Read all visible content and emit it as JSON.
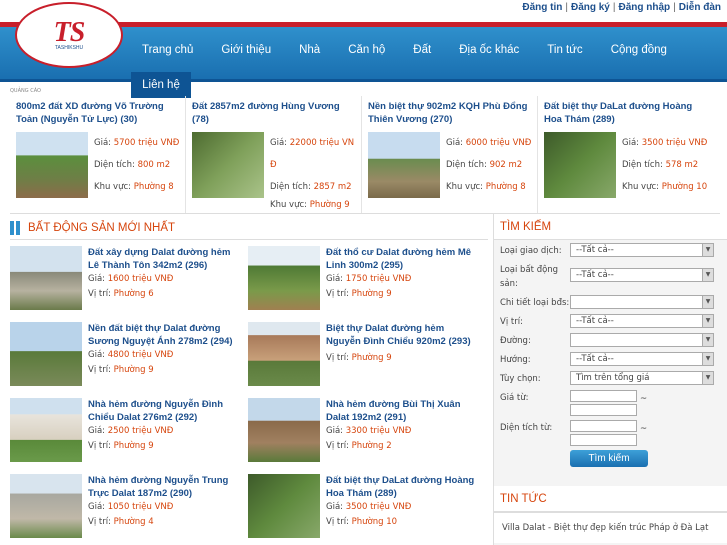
{
  "toplinks": {
    "post": "Đăng tin",
    "register": "Đăng ký",
    "login": "Đăng nhập",
    "forum": "Diễn đàn",
    "sep": "|"
  },
  "logo": {
    "mark": "TS",
    "sub": "TASHIKSHU"
  },
  "nav": [
    "Trang chủ",
    "Giới thiệu",
    "Nhà",
    "Căn hộ",
    "Đất",
    "Địa ốc khác",
    "Tin tức",
    "Cộng đồng"
  ],
  "nav_contact": "Liên hệ",
  "ad_label": "QUẢNG CÁO",
  "labels": {
    "price": "Giá:",
    "area": "Diện tích:",
    "region": "Khu vực:",
    "location": "Vị trí:"
  },
  "featured": [
    {
      "title": "800m2 đất XD đường Võ Trường Toản (Nguyễn Tử Lực) (30)",
      "price": "5700 triệu VNĐ",
      "area": "800 m2",
      "region": "Phường 8"
    },
    {
      "title": "Đất 2857m2 đường Hùng Vương (78)",
      "price": "22000 triệu VN Đ",
      "area": "2857 m2",
      "region": "Phường 9"
    },
    {
      "title": "Nền biệt thự 902m2 KQH Phù Đổng Thiên Vương (270)",
      "price": "6000 triệu VNĐ",
      "area": "902 m2",
      "region": "Phường 8"
    },
    {
      "title": "Đất biệt thự DaLat đường Hoàng Hoa Thám (289)",
      "price": "3500 triệu VNĐ",
      "area": "578 m2",
      "region": "Phường 10"
    }
  ],
  "new_section_title": "BẤT ĐỘNG SẢN MỚI NHẤT",
  "listings": [
    {
      "title": "Đất xây dựng Dalat đường hẻm Lê Thành Tôn 342m2 (296)",
      "price": "1600 triệu VNĐ",
      "location": "Phường 6"
    },
    {
      "title": "Đất thổ cư Dalat đường hẻm Mê Linh 300m2 (295)",
      "price": "1750 triệu VNĐ",
      "location": "Phường 9"
    },
    {
      "title": "Nền đất biệt thự Dalat đường Sương Nguyệt Ánh 278m2 (294)",
      "price": "4800 triệu VNĐ",
      "location": "Phường 9"
    },
    {
      "title": "Biệt thự Dalat đường hẻm Nguyễn Đình Chiểu 920m2 (293)",
      "price": "",
      "location": "Phường 9"
    },
    {
      "title": "Nhà hẻm đường Nguyễn Đình Chiểu Dalat 276m2 (292)",
      "price": "2500 triệu VNĐ",
      "location": "Phường 9"
    },
    {
      "title": "Nhà hẻm đường Bùi Thị Xuân Dalat 192m2 (291)",
      "price": "3300 triệu VNĐ",
      "location": "Phường 2"
    },
    {
      "title": "Nhà hẻm đường Nguyễn Trung Trực Dalat 187m2 (290)",
      "price": "1050 triệu VNĐ",
      "location": "Phường 4"
    },
    {
      "title": "Đất biệt thự DaLat đường Hoàng Hoa Thám (289)",
      "price": "3500 triệu VNĐ",
      "location": "Phường 10"
    }
  ],
  "search": {
    "title": "TÌM KIẾM",
    "trans_type_label": "Loại giao dịch:",
    "trans_type_value": "--Tất cả--",
    "prop_type_label": "Loại bất động sản:",
    "prop_type_value": "--Tất cả--",
    "detail_label": "Chi tiết loại bđs:",
    "detail_value": "",
    "location_label": "Vị trí:",
    "location_value": "--Tất cả--",
    "street_label": "Đường:",
    "street_value": "",
    "direction_label": "Hướng:",
    "direction_value": "--Tất cả--",
    "option_label": "Tùy chọn:",
    "option_value": "Tìm trên tổng giá",
    "price_label": "Giá từ:",
    "area_label": "Diện tích từ:",
    "tilde": "~",
    "button": "Tìm kiếm"
  },
  "news": {
    "title": "TIN TỨC",
    "items": [
      "Villa Dalat - Biệt thự đẹp kiến trúc Pháp ở Đà Lạt"
    ]
  }
}
